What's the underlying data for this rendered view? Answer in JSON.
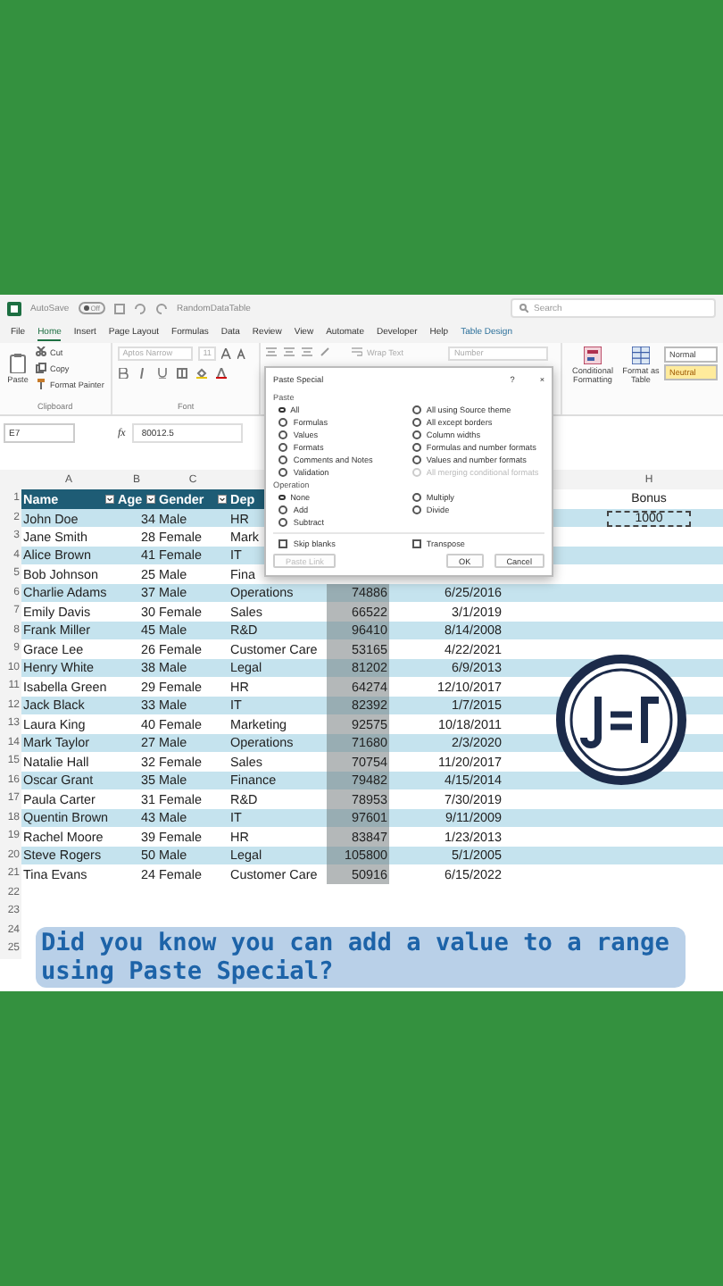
{
  "title_bar": {
    "autosave_label": "AutoSave",
    "autosave_state": "Off",
    "autosave_on": false,
    "file_name": "RandomDataTable",
    "search_placeholder": "Search"
  },
  "ribbon_tabs": [
    {
      "label": "File",
      "selected": false
    },
    {
      "label": "Home",
      "selected": true
    },
    {
      "label": "Insert",
      "selected": false
    },
    {
      "label": "Page Layout",
      "selected": false
    },
    {
      "label": "Formulas",
      "selected": false
    },
    {
      "label": "Data",
      "selected": false
    },
    {
      "label": "Review",
      "selected": false
    },
    {
      "label": "View",
      "selected": false
    },
    {
      "label": "Automate",
      "selected": false
    },
    {
      "label": "Developer",
      "selected": false
    },
    {
      "label": "Help",
      "selected": false
    },
    {
      "label": "Table Design",
      "selected": false
    }
  ],
  "ribbon": {
    "paste": "Paste",
    "cut": "Cut",
    "copy": "Copy",
    "format_painter": "Format Painter",
    "clipboard_group": "Clipboard",
    "font_name": "Aptos Narrow",
    "font_size": "11",
    "font_group": "Font",
    "wrap_text": "Wrap Text",
    "number_format": "Number",
    "conditional_formatting": "Conditional Formatting",
    "format_as_table": "Format as Table",
    "cell_styles": [
      "Normal",
      "Neutral"
    ]
  },
  "formula_bar": {
    "name_box": "E7",
    "fx": "fx",
    "value": "80012.5"
  },
  "sheet": {
    "column_letters_left": [
      "A",
      "B",
      "C"
    ],
    "column_letters_right": [
      "H"
    ],
    "header_row": {
      "n": "1",
      "headers": [
        "Name",
        "Age",
        "Gender",
        "Dep"
      ],
      "h_cell": "Bonus"
    },
    "rows": [
      {
        "n": "2",
        "name": "John Doe",
        "age": "34",
        "gender": "Male",
        "department": "HR",
        "h_cell": "1000",
        "copied": true
      },
      {
        "n": "3",
        "name": "Jane Smith",
        "age": "28",
        "gender": "Female",
        "department": "Mark"
      },
      {
        "n": "4",
        "name": "Alice Brown",
        "age": "41",
        "gender": "Female",
        "department": "IT"
      },
      {
        "n": "5",
        "name": "Bob Johnson",
        "age": "25",
        "gender": "Male",
        "department": "Fina"
      },
      {
        "n": "6",
        "name": "Charlie Adams",
        "age": "37",
        "gender": "Male",
        "department": "Operations",
        "salary": "74886",
        "date": "6/25/2016",
        "salary_selected": true
      },
      {
        "n": "7",
        "name": "Emily Davis",
        "age": "30",
        "gender": "Female",
        "department": "Sales",
        "salary": "66522",
        "date": "3/1/2019",
        "salary_selected": true
      },
      {
        "n": "8",
        "name": "Frank Miller",
        "age": "45",
        "gender": "Male",
        "department": "R&D",
        "salary": "96410",
        "date": "8/14/2008",
        "salary_selected": true
      },
      {
        "n": "9",
        "name": "Grace Lee",
        "age": "26",
        "gender": "Female",
        "department": "Customer Care",
        "salary": "53165",
        "date": "4/22/2021",
        "salary_selected": true
      },
      {
        "n": "10",
        "name": "Henry White",
        "age": "38",
        "gender": "Male",
        "department": "Legal",
        "salary": "81202",
        "date": "6/9/2013",
        "salary_selected": true
      },
      {
        "n": "11",
        "name": "Isabella Green",
        "age": "29",
        "gender": "Female",
        "department": "HR",
        "salary": "64274",
        "date": "12/10/2017",
        "salary_selected": true
      },
      {
        "n": "12",
        "name": "Jack Black",
        "age": "33",
        "gender": "Male",
        "department": "IT",
        "salary": "82392",
        "date": "1/7/2015",
        "salary_selected": true
      },
      {
        "n": "13",
        "name": "Laura King",
        "age": "40",
        "gender": "Female",
        "department": "Marketing",
        "salary": "92575",
        "date": "10/18/2011",
        "salary_selected": true
      },
      {
        "n": "14",
        "name": "Mark Taylor",
        "age": "27",
        "gender": "Male",
        "department": "Operations",
        "salary": "71680",
        "date": "2/3/2020",
        "salary_selected": true
      },
      {
        "n": "15",
        "name": "Natalie Hall",
        "age": "32",
        "gender": "Female",
        "department": "Sales",
        "salary": "70754",
        "date": "11/20/2017",
        "salary_selected": true
      },
      {
        "n": "16",
        "name": "Oscar Grant",
        "age": "35",
        "gender": "Male",
        "department": "Finance",
        "salary": "79482",
        "date": "4/15/2014",
        "salary_selected": true
      },
      {
        "n": "17",
        "name": "Paula Carter",
        "age": "31",
        "gender": "Female",
        "department": "R&D",
        "salary": "78953",
        "date": "7/30/2019",
        "salary_selected": true
      },
      {
        "n": "18",
        "name": "Quentin Brown",
        "age": "43",
        "gender": "Male",
        "department": "IT",
        "salary": "97601",
        "date": "9/11/2009",
        "salary_selected": true
      },
      {
        "n": "19",
        "name": "Rachel Moore",
        "age": "39",
        "gender": "Female",
        "department": "HR",
        "salary": "83847",
        "date": "1/23/2013",
        "salary_selected": true
      },
      {
        "n": "20",
        "name": "Steve Rogers",
        "age": "50",
        "gender": "Male",
        "department": "Legal",
        "salary": "105800",
        "date": "5/1/2005",
        "salary_selected": true
      },
      {
        "n": "21",
        "name": "Tina Evans",
        "age": "24",
        "gender": "Female",
        "department": "Customer Care",
        "salary": "50916",
        "date": "6/15/2022",
        "salary_selected": true
      }
    ],
    "empty_rows": [
      "22",
      "23",
      "24",
      "25"
    ]
  },
  "paste_special": {
    "title": "Paste Special",
    "help": "?",
    "close": "×",
    "paste_label": "Paste",
    "paste_options": [
      {
        "label": "All",
        "selected": true,
        "disabled": false
      },
      {
        "label": "Formulas",
        "selected": false,
        "disabled": false
      },
      {
        "label": "Values",
        "selected": false,
        "disabled": false
      },
      {
        "label": "Formats",
        "selected": false,
        "disabled": false
      },
      {
        "label": "Comments and Notes",
        "selected": false,
        "disabled": false
      },
      {
        "label": "Validation",
        "selected": false,
        "disabled": false
      },
      {
        "label": "All using Source theme",
        "selected": false,
        "disabled": false
      },
      {
        "label": "All except borders",
        "selected": false,
        "disabled": false
      },
      {
        "label": "Column widths",
        "selected": false,
        "disabled": false
      },
      {
        "label": "Formulas and number formats",
        "selected": false,
        "disabled": false
      },
      {
        "label": "Values and number formats",
        "selected": false,
        "disabled": false
      },
      {
        "label": "All merging conditional formats",
        "selected": false,
        "disabled": true
      }
    ],
    "operation_label": "Operation",
    "operation_options": [
      {
        "label": "None",
        "selected": true
      },
      {
        "label": "Add",
        "selected": false
      },
      {
        "label": "Subtract",
        "selected": false
      },
      {
        "label": "Multiply",
        "selected": false
      },
      {
        "label": "Divide",
        "selected": false
      }
    ],
    "checks": [
      {
        "label": "Skip blanks",
        "checked": false
      },
      {
        "label": "Transpose",
        "checked": false
      }
    ],
    "buttons": [
      {
        "label": "Paste Link",
        "disabled": true
      },
      {
        "label": "OK",
        "disabled": false
      },
      {
        "label": "Cancel",
        "disabled": false
      }
    ]
  },
  "caption": "Did you know you can add a value to a range using Paste Special?"
}
